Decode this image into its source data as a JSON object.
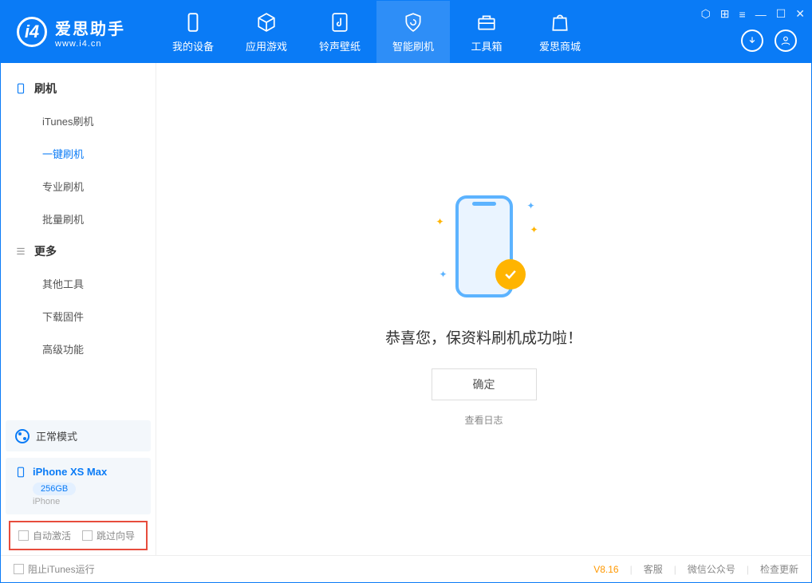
{
  "app": {
    "title": "爱思助手",
    "subtitle": "www.i4.cn"
  },
  "nav": {
    "tabs": [
      {
        "label": "我的设备"
      },
      {
        "label": "应用游戏"
      },
      {
        "label": "铃声壁纸"
      },
      {
        "label": "智能刷机"
      },
      {
        "label": "工具箱"
      },
      {
        "label": "爱思商城"
      }
    ]
  },
  "sidebar": {
    "group1": {
      "title": "刷机",
      "items": [
        "iTunes刷机",
        "一键刷机",
        "专业刷机",
        "批量刷机"
      ]
    },
    "group2": {
      "title": "更多",
      "items": [
        "其他工具",
        "下载固件",
        "高级功能"
      ]
    },
    "mode": "正常模式",
    "device": {
      "name": "iPhone XS Max",
      "storage": "256GB",
      "type": "iPhone"
    },
    "options": {
      "autoActivate": "自动激活",
      "skipGuide": "跳过向导"
    }
  },
  "main": {
    "successText": "恭喜您，保资料刷机成功啦！",
    "okButton": "确定",
    "viewLog": "查看日志"
  },
  "footer": {
    "blockItunes": "阻止iTunes运行",
    "version": "V8.16",
    "support": "客服",
    "wechat": "微信公众号",
    "checkUpdate": "检查更新"
  }
}
